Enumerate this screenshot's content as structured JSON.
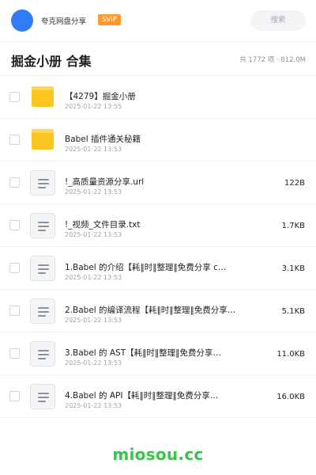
{
  "header": {
    "username": "夸克网盘分享",
    "badge": "SVIP",
    "search_placeholder": "搜索"
  },
  "folder": {
    "title": "掘金小册 合集",
    "meta": "共 1772 项 · 812.0M"
  },
  "files": [
    {
      "name": "【4279】掘金小册",
      "date": "2025-01-22 13:55",
      "size": "",
      "icon": "folder"
    },
    {
      "name": "Babel 插件通关秘籍",
      "date": "2025-01-22 13:53",
      "size": "",
      "icon": "folder"
    },
    {
      "name": "!_高质量资源分享.url",
      "date": "2025-01-22 13:53",
      "size": "122B",
      "icon": "document"
    },
    {
      "name": "!_视频_文件目录.txt",
      "date": "2025-01-22 13:53",
      "size": "1.7KB",
      "icon": "document"
    },
    {
      "name": "1.Babel 的介绍【耗‖时‖整理‖免费分享 c…",
      "date": "2025-01-22 13:53",
      "size": "3.1KB",
      "icon": "document"
    },
    {
      "name": "2.Babel 的编译流程【耗‖时‖整理‖免费分享…",
      "date": "2025-01-22 13:53",
      "size": "5.1KB",
      "icon": "document"
    },
    {
      "name": "3.Babel 的 AST【耗‖时‖整理‖免费分享…",
      "date": "2025-01-22 13:53",
      "size": "11.0KB",
      "icon": "document"
    },
    {
      "name": "4.Babel 的 API【耗‖时‖整理‖免费分享…",
      "date": "2025-01-22 13:53",
      "size": "16.0KB",
      "icon": "document"
    }
  ],
  "watermark": "miosou.cc",
  "colors": {
    "avatar": "#2f7cf6",
    "badge": "#ff9a2e",
    "folder": "#fcc621",
    "watermark": "#3cc24a"
  }
}
